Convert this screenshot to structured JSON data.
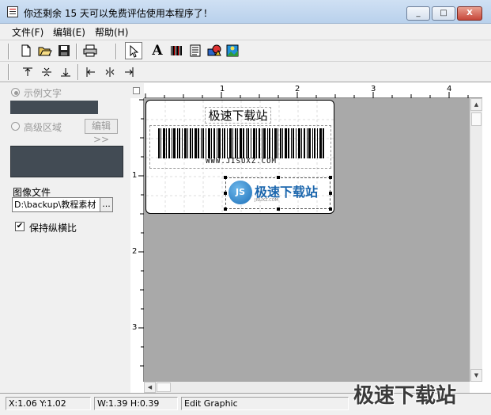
{
  "window": {
    "title": "你还剩余 15 天可以免费评估使用本程序了！",
    "controls": [
      "_",
      "□",
      "X"
    ]
  },
  "menu": [
    "文件(F)",
    "编辑(E)",
    "帮助(H)"
  ],
  "toolbar1": {
    "icons": [
      "new-file-icon",
      "open-folder-icon",
      "save-disk-icon",
      "print-icon",
      "pointer-arrow-icon",
      "text-tool-icon",
      "barcode-tool-icon",
      "document-tool-icon",
      "shapes-tool-icon",
      "image-tool-icon"
    ],
    "text_tool_glyph": "A"
  },
  "toolbar2": {
    "icons": [
      "align-top-icon",
      "align-middle-icon",
      "align-bottom-icon",
      "align-left-icon",
      "align-center-icon",
      "align-right-icon"
    ]
  },
  "left_panel": {
    "sample_text_label": "示例文字",
    "advanced_region_label": "高级区域",
    "edit_button": "编辑>>",
    "image_file_label": "图像文件",
    "image_path": "D:\\backup\\教程素材",
    "browse_button": "...",
    "keep_ratio_label": "保持纵横比",
    "keep_ratio_checked": true,
    "sample_text_selected": true
  },
  "rulers": {
    "top": [
      "1",
      "2",
      "3",
      "4"
    ],
    "left": [
      "1",
      "2",
      "3"
    ]
  },
  "label": {
    "title_text": "极速下载站",
    "barcode_text": "WWW.JISUXZ.COM",
    "logo_badge": "JS",
    "logo_name": "极速下载站",
    "logo_subtitle": "JISUXZ.COM"
  },
  "status": {
    "position": "X:1.06  Y:1.02",
    "size": "W:1.39  H:0.39",
    "mode": "Edit Graphic"
  },
  "watermark": "极速下载站"
}
